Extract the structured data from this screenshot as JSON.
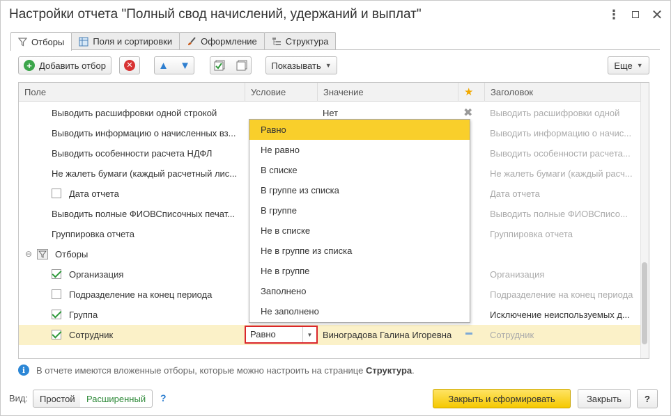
{
  "window": {
    "title": "Настройки отчета \"Полный свод начислений, удержаний и выплат\"",
    "more_icon": "⋮"
  },
  "tabs": [
    {
      "label": "Отборы",
      "icon": "funnel-icon",
      "active": true
    },
    {
      "label": "Поля и сортировки",
      "icon": "table-icon",
      "active": false
    },
    {
      "label": "Оформление",
      "icon": "brush-icon",
      "active": false
    },
    {
      "label": "Структура",
      "icon": "tree-icon",
      "active": false
    }
  ],
  "toolbar": {
    "add_filter": "Добавить отбор",
    "show": "Показывать",
    "more": "Еще"
  },
  "grid": {
    "headers": {
      "field": "Поле",
      "condition": "Условие",
      "value": "Значение",
      "title": "Заголовок"
    },
    "rows": [
      {
        "field": "Выводить расшифровки одной строкой",
        "value": "Нет",
        "title": "Выводить расшифровки одной"
      },
      {
        "field": "Выводить информацию о начисленных вз...",
        "value": "",
        "title": "Выводить информацию о начис..."
      },
      {
        "field": "Выводить особенности расчета НДФЛ",
        "value": "",
        "title": "Выводить особенности расчета..."
      },
      {
        "field": "Не жалеть бумаги (каждый расчетный лис...",
        "value": "",
        "title": "Не жалеть бумаги (каждый расч..."
      },
      {
        "field": "Дата отчета",
        "value": "",
        "title": "Дата отчета"
      },
      {
        "field": "Выводить полные ФИОВСписочных печат...",
        "value": "",
        "title": "Выводить полные ФИОВСписо..."
      },
      {
        "field": "Группировка отчета",
        "value": "",
        "title": "Группировка отчета"
      },
      {
        "field": "Отборы",
        "value": "",
        "title": ""
      },
      {
        "field": "Организация",
        "value": "",
        "title": "Организация"
      },
      {
        "field": "Подразделение на конец периода",
        "value": "",
        "title": "Подразделение на конец периода"
      },
      {
        "field": "Группа",
        "value": "",
        "title": "Исключение неиспользуемых д..."
      },
      {
        "field": "Сотрудник",
        "condition": "Равно",
        "value": "Виноградова Галина Игоревна",
        "title": "Сотрудник"
      }
    ]
  },
  "dropdown": {
    "options": [
      "Равно",
      "Не равно",
      "В списке",
      "В группе из списка",
      "В группе",
      "Не в списке",
      "Не в группе из списка",
      "Не в группе",
      "Заполнено",
      "Не заполнено"
    ],
    "selected": "Равно"
  },
  "info": {
    "text": "В отчете имеются вложенные отборы, которые можно настроить на странице",
    "link": "Структура",
    "end": "."
  },
  "footer": {
    "view_label": "Вид:",
    "simple": "Простой",
    "extended": "Расширенный",
    "help": "?",
    "close_and_generate": "Закрыть и сформировать",
    "close": "Закрыть",
    "question": "?"
  },
  "colors": {
    "accent_yellow": "#f9cf2b",
    "selected_row": "#fbf1c8",
    "highlight_red": "#d9262b",
    "check_green": "#2f9a3b"
  }
}
